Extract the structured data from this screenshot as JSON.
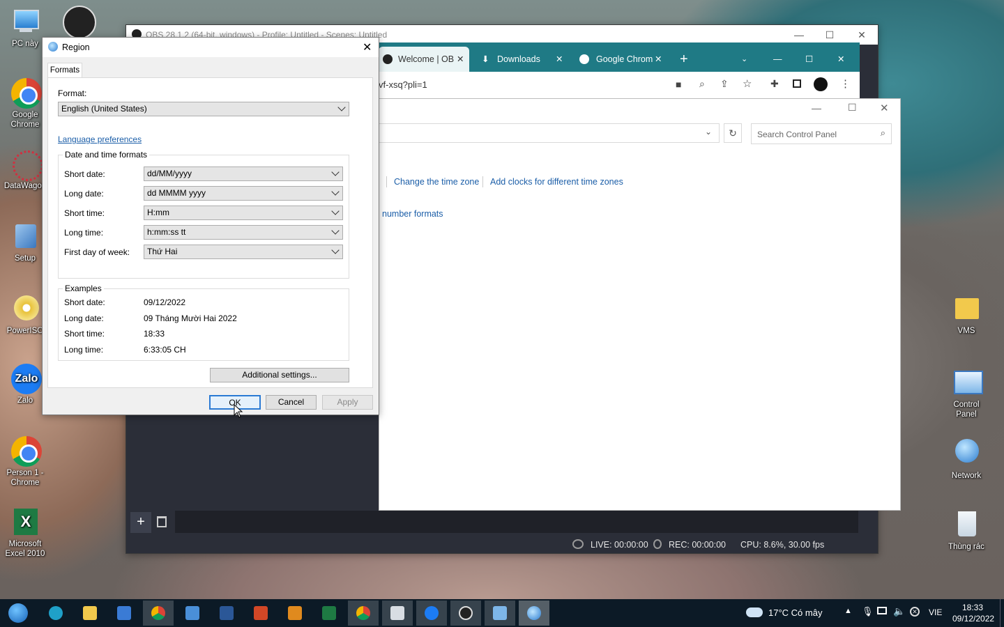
{
  "desktop": {
    "left_icons": [
      "PC này",
      "Google Chrome",
      "DataWagon",
      "Setup",
      "PowerISO",
      "Zalo",
      "Person 1 - Chrome",
      "Microsoft Excel 2010"
    ],
    "right_icons": [
      "VMS",
      "Control Panel",
      "Network",
      "Thùng rác"
    ]
  },
  "obs": {
    "title": "OBS 28.1.2 (64-bit, windows) - Profile: Untitled - Scenes: Untitled",
    "status": {
      "live": "LIVE: 00:00:00",
      "rec": "REC: 00:00:00",
      "cpu": "CPU: 8.6%, 30.00 fps"
    }
  },
  "chrome": {
    "tabs": [
      "Welcome | OB",
      "Downloads",
      "Google Chrom"
    ],
    "url": "vf-xsq?pli=1"
  },
  "control_panel": {
    "search_placeholder": "Search Control Panel",
    "links": [
      "Change the time zone",
      "Add clocks for different time zones",
      "number formats"
    ]
  },
  "region": {
    "title": "Region",
    "tab": "Formats",
    "format_label": "Format:",
    "format_value": "English (United States)",
    "language_link": "Language preferences",
    "datetime_group": "Date and time formats",
    "fields": [
      {
        "label": "Short date:",
        "value": "dd/MM/yyyy"
      },
      {
        "label": "Long date:",
        "value": "dd MMMM yyyy"
      },
      {
        "label": "Short time:",
        "value": "H:mm"
      },
      {
        "label": "Long time:",
        "value": "h:mm:ss tt"
      },
      {
        "label": "First day of week:",
        "value": "Thứ Hai"
      }
    ],
    "examples_group": "Examples",
    "examples": [
      {
        "label": "Short date:",
        "value": "09/12/2022"
      },
      {
        "label": "Long date:",
        "value": "09 Tháng Mười Hai 2022"
      },
      {
        "label": "Short time:",
        "value": "18:33"
      },
      {
        "label": "Long time:",
        "value": "6:33:05 CH"
      }
    ],
    "additional_settings": "Additional settings...",
    "ok": "OK",
    "cancel": "Cancel",
    "apply": "Apply"
  },
  "taskbar": {
    "weather": "17°C  Có mây",
    "lang": "VIE",
    "time": "18:33",
    "date": "09/12/2022"
  }
}
